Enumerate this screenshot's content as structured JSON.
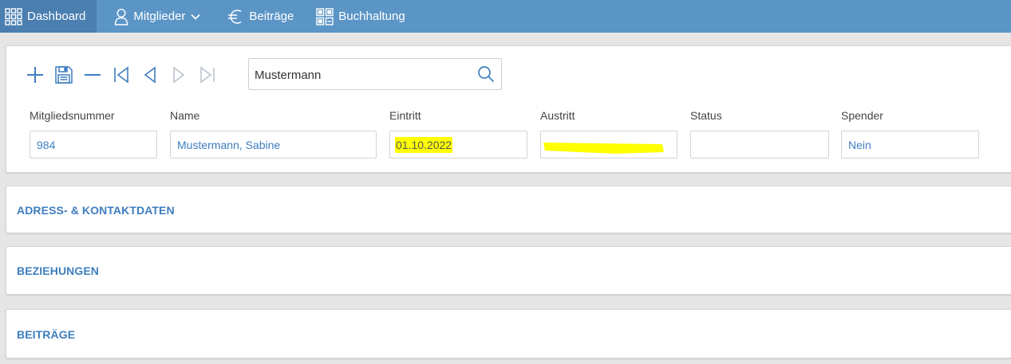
{
  "nav": {
    "items": [
      {
        "label": "Dashboard",
        "icon": "grid-icon",
        "active": true
      },
      {
        "label": "Mitglieder",
        "icon": "user-icon",
        "has_dropdown": true
      },
      {
        "label": "Beiträge",
        "icon": "euro-icon"
      },
      {
        "label": "Buchhaltung",
        "icon": "ledger-icon"
      }
    ]
  },
  "toolbar": {
    "buttons": [
      "add-icon",
      "save-icon",
      "remove-icon",
      "first-record-icon",
      "previous-record-icon",
      "next-record-icon",
      "last-record-icon"
    ]
  },
  "search": {
    "value": "Mustermann",
    "icon": "search-icon"
  },
  "member": {
    "fields": [
      {
        "label": "Mitgliedsnummer",
        "value": "984"
      },
      {
        "label": "Name",
        "value": "Mustermann, Sabine"
      },
      {
        "label": "Eintritt",
        "value": "01.10.2022",
        "highlight": "#ffff00"
      },
      {
        "label": "Austritt",
        "value": "",
        "redacted": true
      },
      {
        "label": "Status",
        "value": ""
      },
      {
        "label": "Spender",
        "value": "Nein"
      }
    ]
  },
  "sections": [
    {
      "title": "ADRESS- & KONTAKTDATEN"
    },
    {
      "title": "BEZIEHUNGEN"
    },
    {
      "title": "BEITRÄGE"
    }
  ],
  "colors": {
    "nav_bg": "#5b95c6",
    "nav_active_bg": "#4a7fb0",
    "accent": "#3e7dbf",
    "highlight": "#ffff00"
  }
}
